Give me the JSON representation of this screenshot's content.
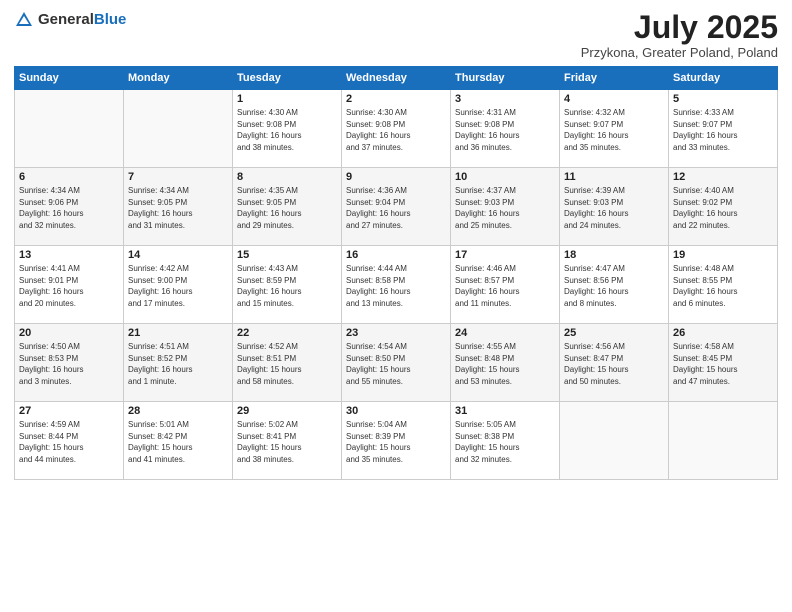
{
  "logo": {
    "general": "General",
    "blue": "Blue"
  },
  "title": "July 2025",
  "subtitle": "Przykona, Greater Poland, Poland",
  "headers": [
    "Sunday",
    "Monday",
    "Tuesday",
    "Wednesday",
    "Thursday",
    "Friday",
    "Saturday"
  ],
  "weeks": [
    [
      {
        "day": "",
        "info": ""
      },
      {
        "day": "",
        "info": ""
      },
      {
        "day": "1",
        "info": "Sunrise: 4:30 AM\nSunset: 9:08 PM\nDaylight: 16 hours\nand 38 minutes."
      },
      {
        "day": "2",
        "info": "Sunrise: 4:30 AM\nSunset: 9:08 PM\nDaylight: 16 hours\nand 37 minutes."
      },
      {
        "day": "3",
        "info": "Sunrise: 4:31 AM\nSunset: 9:08 PM\nDaylight: 16 hours\nand 36 minutes."
      },
      {
        "day": "4",
        "info": "Sunrise: 4:32 AM\nSunset: 9:07 PM\nDaylight: 16 hours\nand 35 minutes."
      },
      {
        "day": "5",
        "info": "Sunrise: 4:33 AM\nSunset: 9:07 PM\nDaylight: 16 hours\nand 33 minutes."
      }
    ],
    [
      {
        "day": "6",
        "info": "Sunrise: 4:34 AM\nSunset: 9:06 PM\nDaylight: 16 hours\nand 32 minutes."
      },
      {
        "day": "7",
        "info": "Sunrise: 4:34 AM\nSunset: 9:05 PM\nDaylight: 16 hours\nand 31 minutes."
      },
      {
        "day": "8",
        "info": "Sunrise: 4:35 AM\nSunset: 9:05 PM\nDaylight: 16 hours\nand 29 minutes."
      },
      {
        "day": "9",
        "info": "Sunrise: 4:36 AM\nSunset: 9:04 PM\nDaylight: 16 hours\nand 27 minutes."
      },
      {
        "day": "10",
        "info": "Sunrise: 4:37 AM\nSunset: 9:03 PM\nDaylight: 16 hours\nand 25 minutes."
      },
      {
        "day": "11",
        "info": "Sunrise: 4:39 AM\nSunset: 9:03 PM\nDaylight: 16 hours\nand 24 minutes."
      },
      {
        "day": "12",
        "info": "Sunrise: 4:40 AM\nSunset: 9:02 PM\nDaylight: 16 hours\nand 22 minutes."
      }
    ],
    [
      {
        "day": "13",
        "info": "Sunrise: 4:41 AM\nSunset: 9:01 PM\nDaylight: 16 hours\nand 20 minutes."
      },
      {
        "day": "14",
        "info": "Sunrise: 4:42 AM\nSunset: 9:00 PM\nDaylight: 16 hours\nand 17 minutes."
      },
      {
        "day": "15",
        "info": "Sunrise: 4:43 AM\nSunset: 8:59 PM\nDaylight: 16 hours\nand 15 minutes."
      },
      {
        "day": "16",
        "info": "Sunrise: 4:44 AM\nSunset: 8:58 PM\nDaylight: 16 hours\nand 13 minutes."
      },
      {
        "day": "17",
        "info": "Sunrise: 4:46 AM\nSunset: 8:57 PM\nDaylight: 16 hours\nand 11 minutes."
      },
      {
        "day": "18",
        "info": "Sunrise: 4:47 AM\nSunset: 8:56 PM\nDaylight: 16 hours\nand 8 minutes."
      },
      {
        "day": "19",
        "info": "Sunrise: 4:48 AM\nSunset: 8:55 PM\nDaylight: 16 hours\nand 6 minutes."
      }
    ],
    [
      {
        "day": "20",
        "info": "Sunrise: 4:50 AM\nSunset: 8:53 PM\nDaylight: 16 hours\nand 3 minutes."
      },
      {
        "day": "21",
        "info": "Sunrise: 4:51 AM\nSunset: 8:52 PM\nDaylight: 16 hours\nand 1 minute."
      },
      {
        "day": "22",
        "info": "Sunrise: 4:52 AM\nSunset: 8:51 PM\nDaylight: 15 hours\nand 58 minutes."
      },
      {
        "day": "23",
        "info": "Sunrise: 4:54 AM\nSunset: 8:50 PM\nDaylight: 15 hours\nand 55 minutes."
      },
      {
        "day": "24",
        "info": "Sunrise: 4:55 AM\nSunset: 8:48 PM\nDaylight: 15 hours\nand 53 minutes."
      },
      {
        "day": "25",
        "info": "Sunrise: 4:56 AM\nSunset: 8:47 PM\nDaylight: 15 hours\nand 50 minutes."
      },
      {
        "day": "26",
        "info": "Sunrise: 4:58 AM\nSunset: 8:45 PM\nDaylight: 15 hours\nand 47 minutes."
      }
    ],
    [
      {
        "day": "27",
        "info": "Sunrise: 4:59 AM\nSunset: 8:44 PM\nDaylight: 15 hours\nand 44 minutes."
      },
      {
        "day": "28",
        "info": "Sunrise: 5:01 AM\nSunset: 8:42 PM\nDaylight: 15 hours\nand 41 minutes."
      },
      {
        "day": "29",
        "info": "Sunrise: 5:02 AM\nSunset: 8:41 PM\nDaylight: 15 hours\nand 38 minutes."
      },
      {
        "day": "30",
        "info": "Sunrise: 5:04 AM\nSunset: 8:39 PM\nDaylight: 15 hours\nand 35 minutes."
      },
      {
        "day": "31",
        "info": "Sunrise: 5:05 AM\nSunset: 8:38 PM\nDaylight: 15 hours\nand 32 minutes."
      },
      {
        "day": "",
        "info": ""
      },
      {
        "day": "",
        "info": ""
      }
    ]
  ]
}
